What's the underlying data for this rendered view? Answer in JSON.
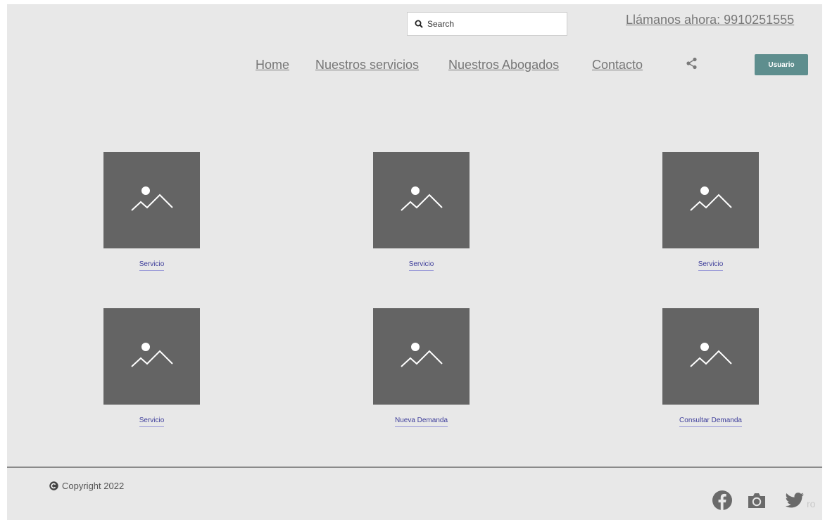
{
  "header": {
    "search_placeholder": "Search",
    "phone": "Llámanos ahora: 9910251555",
    "nav": [
      "Home",
      "Nuestros servicios",
      "Nuestros Abogados",
      "Contacto"
    ],
    "share_icon": "share-icon",
    "user_button": "Usuario",
    "user_button_color": "#5e8e8e"
  },
  "tiles": [
    {
      "label": "Servicio",
      "icon": "image-placeholder-icon"
    },
    {
      "label": "Servicio",
      "icon": "image-placeholder-icon"
    },
    {
      "label": "Servicio",
      "icon": "image-placeholder-icon"
    },
    {
      "label": "Servicio",
      "icon": "image-placeholder-icon"
    },
    {
      "label": "Nueva Demanda",
      "icon": "image-placeholder-icon"
    },
    {
      "label": "Consultar Demanda",
      "icon": "image-placeholder-icon"
    }
  ],
  "footer": {
    "copyright": "Copyright 2022",
    "social_icons": [
      "facebook-icon",
      "instagram-icon",
      "twitter-icon"
    ],
    "ghost_text": "ro"
  }
}
